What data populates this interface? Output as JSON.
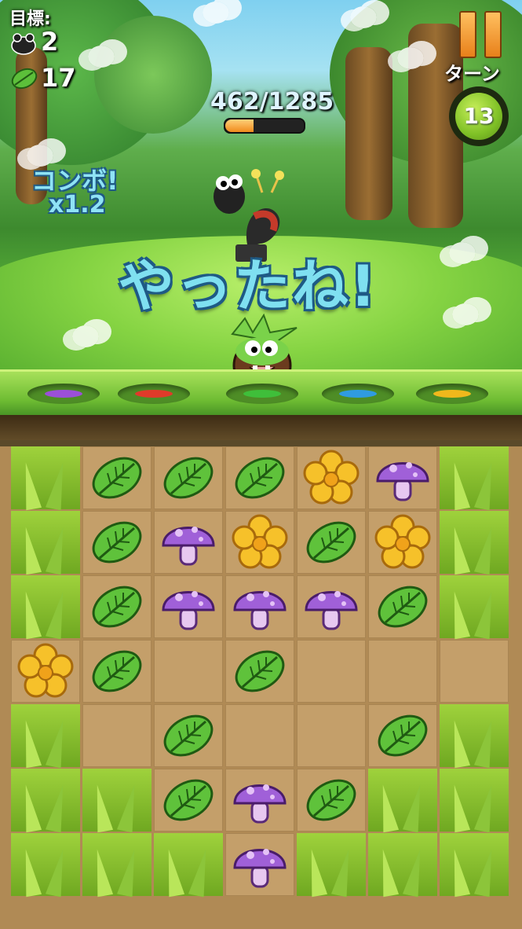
{
  "hud": {
    "goal_label": "目標:",
    "goal_enemy_count": "2",
    "goal_leaf_count": "17",
    "score_text": "462/1285",
    "score_progress": 0.36,
    "turn_label": "ターン",
    "turns_left": "13"
  },
  "effects": {
    "combo_label": "コンボ!",
    "combo_multiplier": "x1.2",
    "banner": "やったね!"
  },
  "icons": {
    "goal_enemy": "beetle-enemy-icon",
    "goal_leaf": "leaf-icon",
    "pause": "pause-icon"
  },
  "pads": [
    {
      "color": "#9b4fd8"
    },
    {
      "color": "#e03a2a"
    },
    {
      "color": "#3fbf3a"
    },
    {
      "color": "#2f9be0"
    },
    {
      "color": "#f0b81c"
    }
  ],
  "board": {
    "rows": [
      [
        "grass",
        "leaf",
        "leaf",
        "leaf",
        "flower",
        "mushroom",
        "grass"
      ],
      [
        "grass",
        "leaf",
        "mushroom",
        "flower",
        "leaf",
        "flower",
        "grass"
      ],
      [
        "grass",
        "leaf",
        "mushroom",
        "mushroom",
        "mushroom",
        "leaf",
        "grass"
      ],
      [
        "flower",
        "leaf",
        "empty",
        "leaf",
        "empty",
        "empty",
        "empty"
      ],
      [
        "grass",
        "empty",
        "leaf",
        "empty",
        "empty",
        "leaf",
        "grass"
      ],
      [
        "grass",
        "grass",
        "leaf",
        "mushroom",
        "leaf",
        "grass",
        "grass"
      ],
      [
        "grass",
        "grass",
        "grass",
        "mushroom",
        "grass",
        "grass",
        "grass"
      ]
    ]
  }
}
